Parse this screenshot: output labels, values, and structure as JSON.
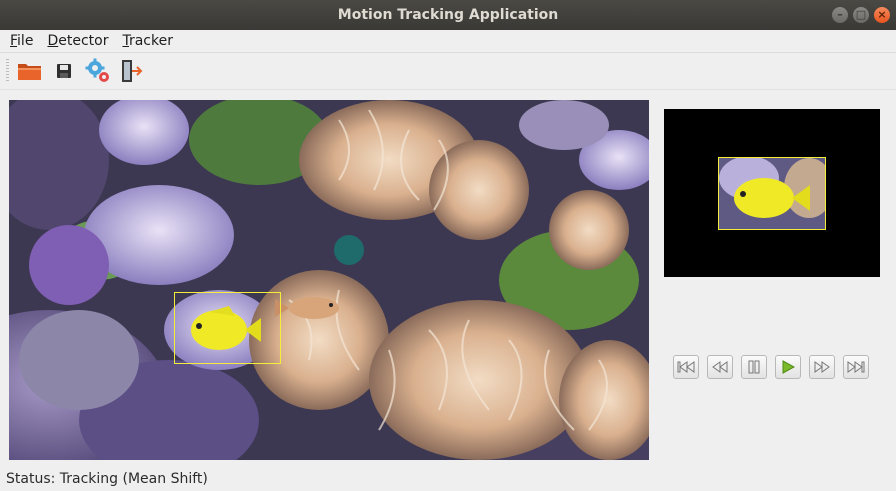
{
  "window": {
    "title": "Motion Tracking Application",
    "controls": [
      "minimize-icon",
      "maximize-icon",
      "close-icon"
    ]
  },
  "menu": [
    {
      "label": "File",
      "mnemonic": "F",
      "rest": "ile"
    },
    {
      "label": "Detector",
      "mnemonic": "D",
      "rest": "etector"
    },
    {
      "label": "Tracker",
      "mnemonic": "T",
      "rest": "racker"
    }
  ],
  "toolbar": {
    "icons": [
      "open-folder-icon",
      "save-icon",
      "settings-gears-icon",
      "exit-icon"
    ]
  },
  "player": {
    "icons": [
      "skip-to-start-icon",
      "step-back-icon",
      "pause-icon",
      "play-icon",
      "step-forward-icon",
      "skip-to-end-icon"
    ]
  },
  "colors": {
    "tracking_box": "#f2ee3a",
    "play_accent": "#7ab929",
    "folder_accent": "#e8642a"
  },
  "status": {
    "text": "Status: Tracking (Mean Shift)"
  }
}
